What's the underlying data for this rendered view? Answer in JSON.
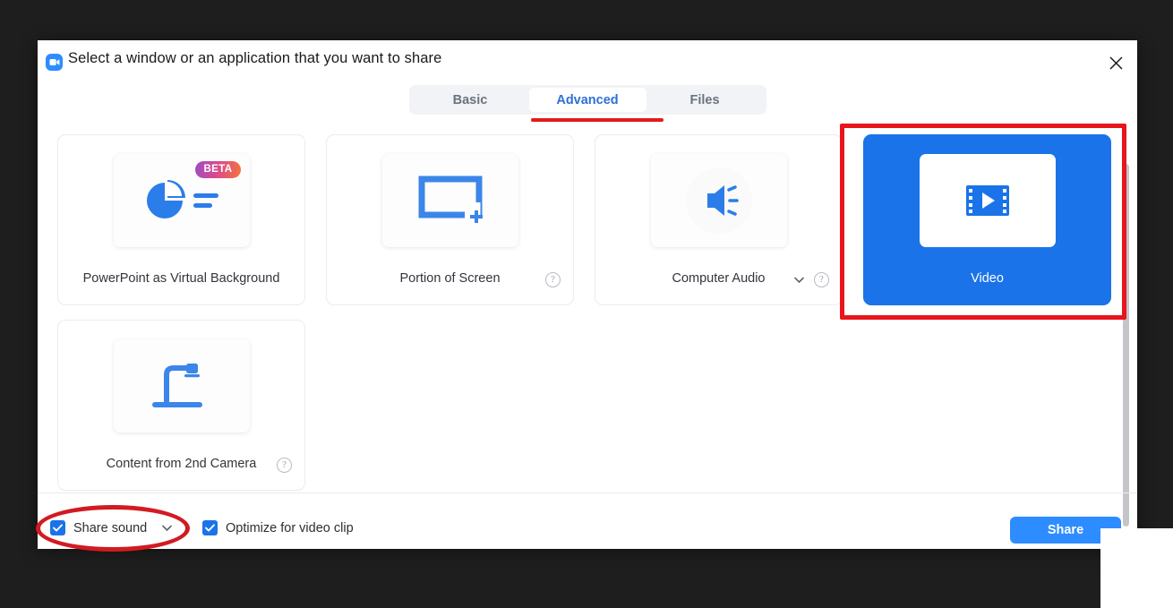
{
  "dialog": {
    "title": "Select a window or an application that you want to share",
    "logo_icon": "zoom-video-logo-icon",
    "close_icon": "close-icon"
  },
  "tabs": [
    {
      "label": "Basic",
      "active": false
    },
    {
      "label": "Advanced",
      "active": true
    },
    {
      "label": "Files",
      "active": false
    }
  ],
  "cards": [
    {
      "label": "PowerPoint as Virtual Background",
      "icon": "pie-chart-icon",
      "badge": "BETA",
      "has_help": false,
      "has_chevron": false,
      "selected": false
    },
    {
      "label": "Portion of Screen",
      "icon": "screen-portion-crosshair-icon",
      "has_help": true,
      "has_chevron": false,
      "selected": false
    },
    {
      "label": "Computer Audio",
      "icon": "speaker-audio-icon",
      "has_help": true,
      "has_chevron": true,
      "selected": false
    },
    {
      "label": "Video",
      "icon": "video-film-play-icon",
      "has_help": false,
      "has_chevron": false,
      "selected": true
    },
    {
      "label": "Content from 2nd Camera",
      "icon": "document-camera-icon",
      "has_help": true,
      "has_chevron": false,
      "selected": false
    }
  ],
  "footer": {
    "share_sound": {
      "label": "Share sound",
      "checked": true,
      "chevron_icon": "chevron-down-icon"
    },
    "optimize_video": {
      "label": "Optimize for video clip",
      "checked": true
    },
    "share_button": "Share"
  },
  "annotations": {
    "video_card_highlight_color": "#e8151c",
    "share_sound_ellipse_color": "#d11b22",
    "advanced_tab_underline_color": "#e01c1c"
  },
  "colors": {
    "accent_blue": "#2d8cff",
    "selected_blue": "#1a73e8",
    "tab_active_text": "#2d71d4",
    "backdrop": "#1e1e1e"
  }
}
